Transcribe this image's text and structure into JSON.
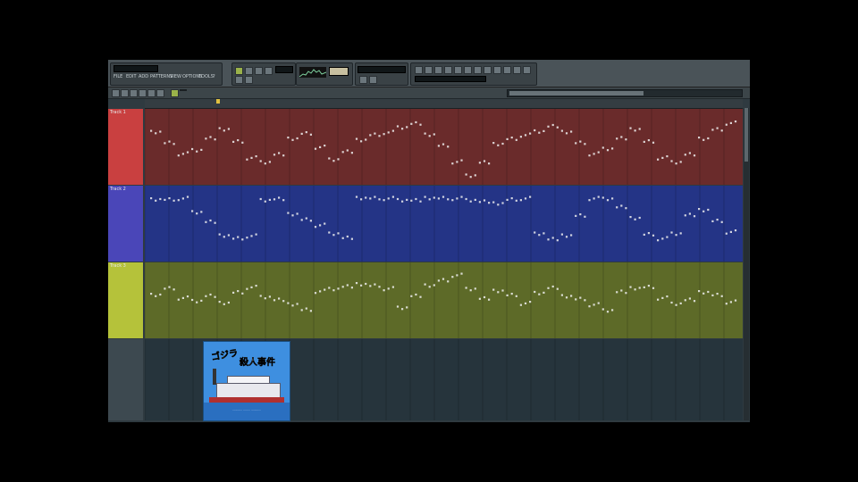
{
  "toolbar": {
    "menu": [
      "FILE",
      "EDIT",
      "ADD",
      "PATTERNS",
      "VIEW",
      "OPTIONS",
      "TOOLS",
      "?"
    ],
    "lcd_tempo": "",
    "lcd_time": ""
  },
  "playlist": {
    "zoom_label": "",
    "tracks": [
      {
        "name": "Track 1",
        "clip_label": "",
        "color": "#7a3232",
        "lane_color": "#6a2b2b",
        "header_color": "#c94040"
      },
      {
        "name": "Track 2",
        "clip_label": "",
        "color": "#2f3f9a",
        "lane_color": "#243486",
        "header_color": "#4a46b8"
      },
      {
        "name": "Track 3",
        "clip_label": "",
        "color": "#6f7a2a",
        "lane_color": "#5d6a28",
        "header_color": "#b5c23a"
      },
      {
        "name": "",
        "clip_label": "",
        "color": "#2b3a44",
        "lane_color": "#26343c",
        "header_color": "#3d4950"
      }
    ]
  },
  "thumbnail": {
    "title_line1": "ゴジラ",
    "title_line2": "殺人事件",
    "credit": "............ ........ ............"
  },
  "note_seed": [
    [
      0.26,
      0.42,
      0.58,
      0.52,
      0.34,
      0.22,
      0.4,
      0.64,
      0.7,
      0.58,
      0.36,
      0.28,
      0.48,
      0.66,
      0.54,
      0.38,
      0.3,
      0.26,
      0.18,
      0.12,
      0.3,
      0.46,
      0.7,
      0.9,
      0.7,
      0.44,
      0.36,
      0.3,
      0.24,
      0.16,
      0.26,
      0.42,
      0.58,
      0.5,
      0.34,
      0.22,
      0.4,
      0.64,
      0.7,
      0.58,
      0.36,
      0.22,
      0.12
    ],
    [
      0.12,
      0.12,
      0.1,
      0.3,
      0.44,
      0.66,
      0.7,
      0.66,
      0.12,
      0.1,
      0.34,
      0.42,
      0.5,
      0.62,
      0.68,
      0.1,
      0.1,
      0.1,
      0.12,
      0.12,
      0.1,
      0.1,
      0.1,
      0.12,
      0.14,
      0.18,
      0.12,
      0.1,
      0.62,
      0.7,
      0.66,
      0.36,
      0.1,
      0.1,
      0.22,
      0.4,
      0.64,
      0.7,
      0.62,
      0.34,
      0.28,
      0.44,
      0.6
    ],
    [
      0.4,
      0.3,
      0.44,
      0.48,
      0.4,
      0.52,
      0.36,
      0.28,
      0.42,
      0.46,
      0.54,
      0.62,
      0.34,
      0.3,
      0.26,
      0.24,
      0.26,
      0.3,
      0.58,
      0.4,
      0.26,
      0.18,
      0.1,
      0.3,
      0.44,
      0.34,
      0.4,
      0.52,
      0.36,
      0.28,
      0.42,
      0.46,
      0.54,
      0.62,
      0.34,
      0.3,
      0.28,
      0.44,
      0.52,
      0.46,
      0.36,
      0.4,
      0.5
    ],
    []
  ]
}
